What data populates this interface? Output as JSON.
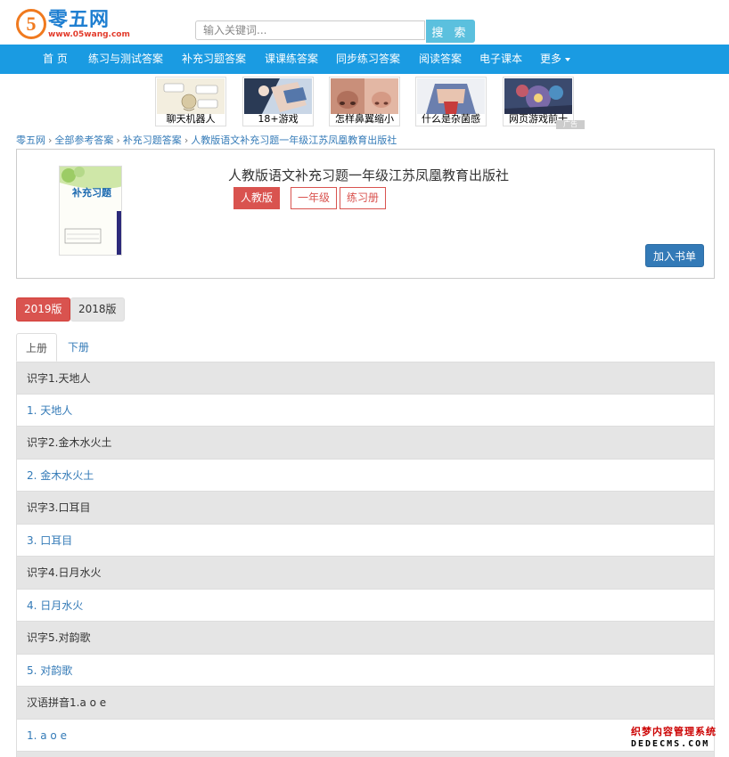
{
  "site": {
    "logo_digit": "5",
    "logo_name": "零五网",
    "logo_url": "www.05wang.com"
  },
  "search": {
    "placeholder": "输入关键词...",
    "button": "搜 索"
  },
  "nav": {
    "items": [
      "首 页",
      "练习与测试答案",
      "补充习题答案",
      "课课练答案",
      "同步练习答案",
      "阅读答案",
      "电子课本",
      "更多"
    ]
  },
  "ads": {
    "items": [
      "聊天机器人",
      "18+游戏",
      "怎样鼻翼缩小",
      "什么是杂菌感",
      "网页游戏前十"
    ],
    "badge": "广告"
  },
  "breadcrumb": [
    "零五网",
    "全部参考答案",
    "补充习题答案",
    "人教版语文补充习题一年级江苏凤凰教育出版社"
  ],
  "book": {
    "cover_title": "补充习题",
    "title": "人教版语文补充习题一年级江苏凤凰教育出版社",
    "tags": [
      "人教版",
      "一年级",
      "练习册"
    ],
    "add_shelf": "加入书单"
  },
  "editions": [
    "2019版",
    "2018版"
  ],
  "tabs": [
    "上册",
    "下册"
  ],
  "chapters": [
    {
      "header": "识字1.天地人",
      "link": "1. 天地人"
    },
    {
      "header": "识字2.金木水火土",
      "link": "2. 金木水火土"
    },
    {
      "header": "识字3.口耳目",
      "link": "3. 口耳目"
    },
    {
      "header": "识字4.日月水火",
      "link": "4. 日月水火"
    },
    {
      "header": "识字5.对韵歌",
      "link": "5. 对韵歌"
    },
    {
      "header": "汉语拼音1.a o e",
      "link": "1. a o e"
    }
  ],
  "watermark": {
    "line1": "织梦内容管理系统",
    "line2": "DEDECMS.COM"
  },
  "colors": {
    "nav_bg": "#1a9be2",
    "search_btn": "#5bc0de",
    "accent_red": "#d9534f",
    "link_blue": "#337ab7"
  }
}
